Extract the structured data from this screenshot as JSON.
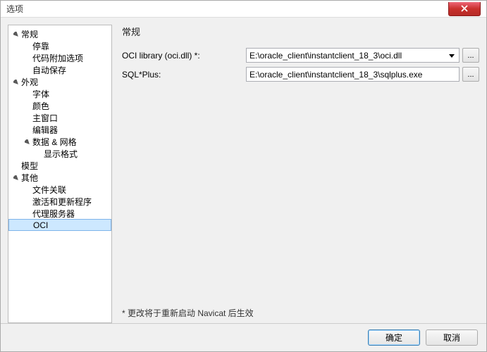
{
  "window": {
    "title": "选项"
  },
  "sidebar": {
    "items": [
      {
        "label": "常规",
        "level": 0,
        "expandable": true,
        "selected": false
      },
      {
        "label": "停靠",
        "level": 1,
        "expandable": false,
        "selected": false
      },
      {
        "label": "代码附加选项",
        "level": 1,
        "expandable": false,
        "selected": false
      },
      {
        "label": "自动保存",
        "level": 1,
        "expandable": false,
        "selected": false
      },
      {
        "label": "外观",
        "level": 0,
        "expandable": true,
        "selected": false
      },
      {
        "label": "字体",
        "level": 1,
        "expandable": false,
        "selected": false
      },
      {
        "label": "颜色",
        "level": 1,
        "expandable": false,
        "selected": false
      },
      {
        "label": "主窗口",
        "level": 1,
        "expandable": false,
        "selected": false
      },
      {
        "label": "编辑器",
        "level": 1,
        "expandable": false,
        "selected": false
      },
      {
        "label": "数据 & 网格",
        "level": 1,
        "expandable": true,
        "selected": false
      },
      {
        "label": "显示格式",
        "level": 2,
        "expandable": false,
        "selected": false
      },
      {
        "label": "模型",
        "level": 0,
        "expandable": false,
        "selected": false
      },
      {
        "label": "其他",
        "level": 0,
        "expandable": true,
        "selected": false
      },
      {
        "label": "文件关联",
        "level": 1,
        "expandable": false,
        "selected": false
      },
      {
        "label": "激活和更新程序",
        "level": 1,
        "expandable": false,
        "selected": false
      },
      {
        "label": "代理服务器",
        "level": 1,
        "expandable": false,
        "selected": false
      },
      {
        "label": "OCI",
        "level": 1,
        "expandable": false,
        "selected": true
      }
    ]
  },
  "panel": {
    "title": "常规",
    "rows": [
      {
        "label": "OCI library (oci.dll) *:",
        "type": "combo",
        "value": "E:\\oracle_client\\instantclient_18_3\\oci.dll",
        "browse": "..."
      },
      {
        "label": "SQL*Plus:",
        "type": "text",
        "value": "E:\\oracle_client\\instantclient_18_3\\sqlplus.exe",
        "browse": "..."
      }
    ],
    "note": "* 更改将于重新启动 Navicat 后生效"
  },
  "footer": {
    "ok": "确定",
    "cancel": "取消"
  }
}
